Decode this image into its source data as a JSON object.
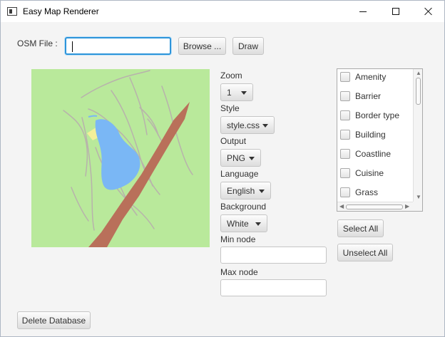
{
  "window": {
    "title": "Easy Map Renderer",
    "icons": [
      "app-window-icon",
      "minimize-icon",
      "maximize-icon",
      "close-icon"
    ]
  },
  "osm": {
    "label": "OSM File :",
    "value": "",
    "browse_label": "Browse ...",
    "draw_label": "Draw"
  },
  "controls": {
    "zoom_label": "Zoom",
    "zoom_value": "1",
    "style_label": "Style",
    "style_value": "style.css",
    "output_label": "Output",
    "output_value": "PNG",
    "language_label": "Language",
    "language_value": "English",
    "background_label": "Background",
    "background_value": "White",
    "min_node_label": "Min node",
    "min_node_value": "",
    "max_node_label": "Max node",
    "max_node_value": ""
  },
  "features": {
    "items": [
      {
        "label": "Amenity",
        "checked": false
      },
      {
        "label": "Barrier",
        "checked": false
      },
      {
        "label": "Border type",
        "checked": false
      },
      {
        "label": "Building",
        "checked": false
      },
      {
        "label": "Coastline",
        "checked": false
      },
      {
        "label": "Cuisine",
        "checked": false
      },
      {
        "label": "Grass",
        "checked": false
      }
    ],
    "select_all_label": "Select All",
    "unselect_all_label": "Unselect All"
  },
  "footer": {
    "delete_database_label": "Delete Database"
  },
  "colors": {
    "map_background": "#b9e99b",
    "water": "#7ab7f5",
    "road": "#b9705a",
    "path_lines": "#b8b2ac",
    "sand_patch": "#f3f09a",
    "focus_blue": "#2d94da"
  }
}
